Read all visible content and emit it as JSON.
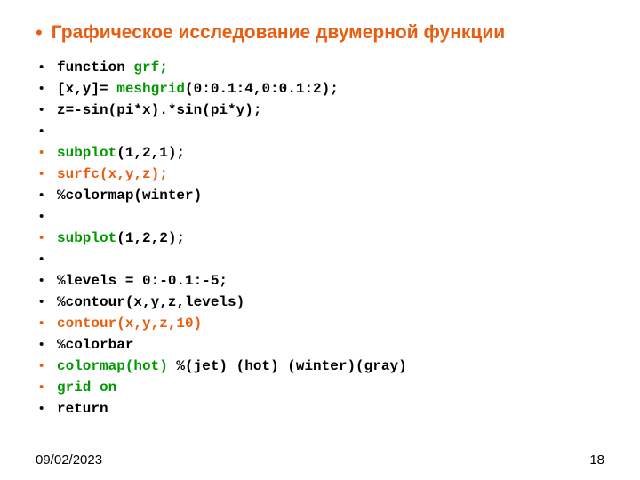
{
  "title": "Графическое исследование двумерной функции",
  "lines": {
    "l1a": "function ",
    "l1b": "grf;",
    "l2a": "[x,y]= ",
    "l2b": "meshgrid",
    "l2c": "(0:0.1:4,0:0.1:2);",
    "l3": "z=-sin(pi*x).*sin(pi*y);",
    "l5a": "subplot",
    "l5b": "(1,2,1);",
    "l6": "surfc(x,y,z);",
    "l7": "%colormap(winter)",
    "l9a": "subplot",
    "l9b": "(1,2,2);",
    "l11": "%levels = 0:-0.1:-5;",
    "l12": "%contour(x,y,z,levels)",
    "l13": "contour(x,y,z,10)",
    "l14": "%colorbar",
    "l15a": "colormap(hot) ",
    "l15b": "%(jet) (hot) (winter)(gray)",
    "l16": "grid on",
    "l17": "return"
  },
  "footer": {
    "date": "09/02/2023",
    "page": "18"
  }
}
